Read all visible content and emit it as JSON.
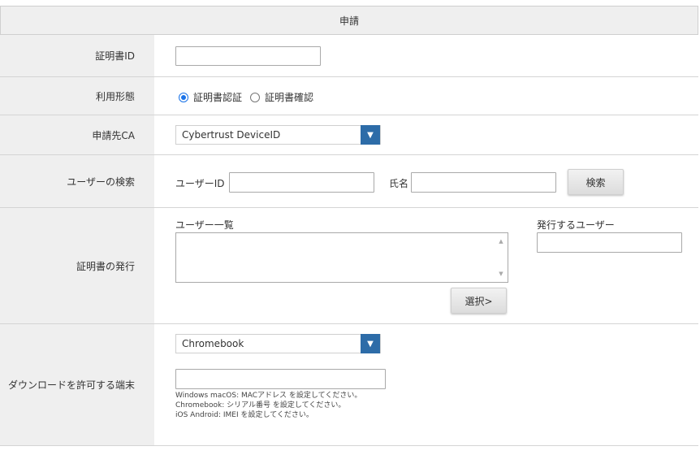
{
  "header": {
    "title": "申請"
  },
  "rows": {
    "cert_id": {
      "label": "証明書ID",
      "value": ""
    },
    "usage": {
      "label": "利用形態",
      "options": [
        {
          "label": "証明書認証",
          "checked": true
        },
        {
          "label": "証明書確認",
          "checked": false
        }
      ]
    },
    "ca": {
      "label": "申請先CA",
      "selected": "Cybertrust DeviceID"
    },
    "user_search": {
      "label": "ユーザーの検索",
      "user_id_label": "ユーザーID",
      "name_label": "氏名",
      "search_button": "検索"
    },
    "issue": {
      "label": "証明書の発行",
      "user_list_label": "ユーザー一覧",
      "issuing_user_label": "発行するユーザー",
      "select_button": "選択>"
    },
    "device": {
      "label": "ダウンロードを許可する端末",
      "selected": "Chromebook",
      "hints": [
        "Windows macOS: MACアドレス を設定してください。",
        "Chromebook: シリアル番号 を設定してください。",
        "iOS Android: IMEI を設定してください。"
      ]
    }
  },
  "colors": {
    "accent": "#2d6ca8",
    "radio": "#1a73e8",
    "label_bg": "#efefef"
  }
}
